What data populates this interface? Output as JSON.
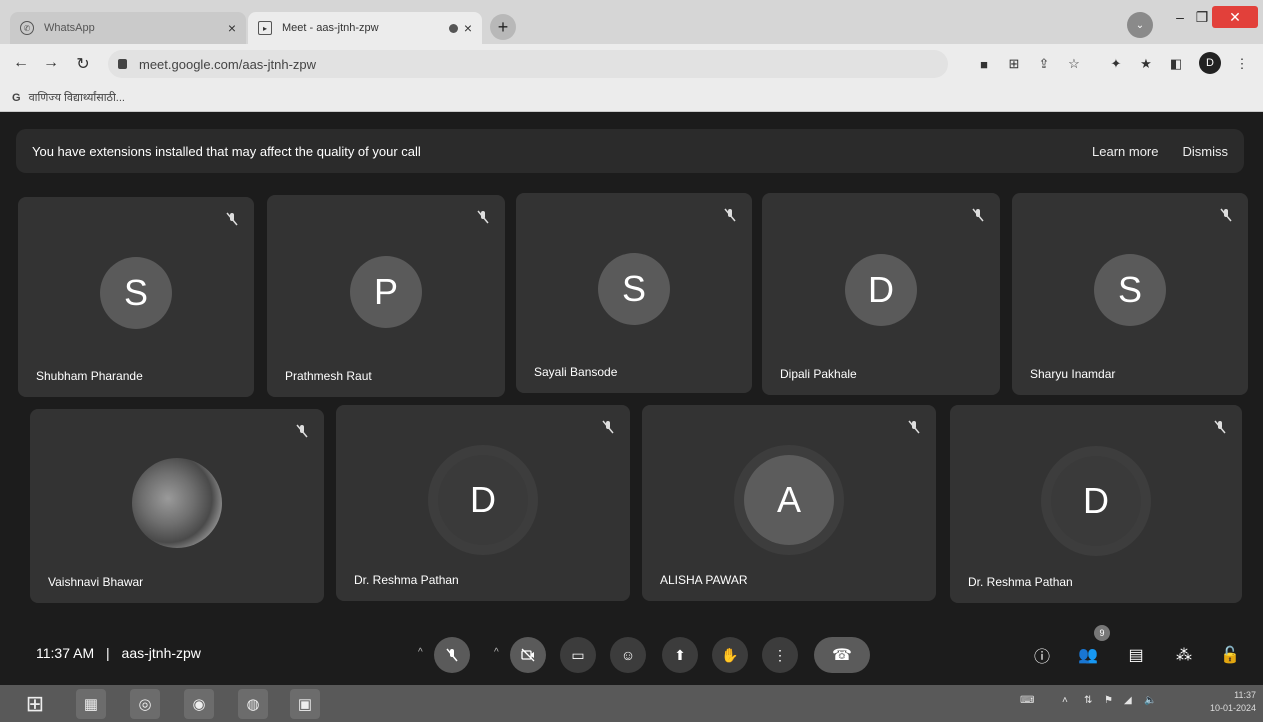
{
  "browser": {
    "tabs": [
      {
        "title": "WhatsApp",
        "icon": "whatsapp-icon"
      },
      {
        "title": "Meet - aas-jtnh-zpw",
        "icon": "meet-icon"
      }
    ],
    "url": "meet.google.com/aas-jtnh-zpw",
    "bookmark": "वाणिज्य विद्यार्थ्यांसाठी...",
    "profile_initial": "D"
  },
  "meet": {
    "banner": {
      "message": "You have extensions installed that may affect the quality of your call",
      "learn_more": "Learn more",
      "dismiss": "Dismiss"
    },
    "participants": [
      {
        "initial": "S",
        "name": "Shubham Pharande"
      },
      {
        "initial": "P",
        "name": "Prathmesh Raut"
      },
      {
        "initial": "S",
        "name": "Sayali Bansode"
      },
      {
        "initial": "D",
        "name": "Dipali Pakhale"
      },
      {
        "initial": "S",
        "name": "Sharyu Inamdar"
      },
      {
        "initial": "",
        "name": "Vaishnavi Bhawar"
      },
      {
        "initial": "D",
        "name": "Dr. Reshma Pathan"
      },
      {
        "initial": "A",
        "name": "ALISHA PAWAR"
      },
      {
        "initial": "D",
        "name": "Dr. Reshma Pathan"
      }
    ],
    "time": "11:37 AM",
    "separator": "|",
    "meeting_code": "aas-jtnh-zpw",
    "participant_count": "9"
  },
  "taskbar": {
    "time": "11:37",
    "date": "10-01-2024"
  }
}
